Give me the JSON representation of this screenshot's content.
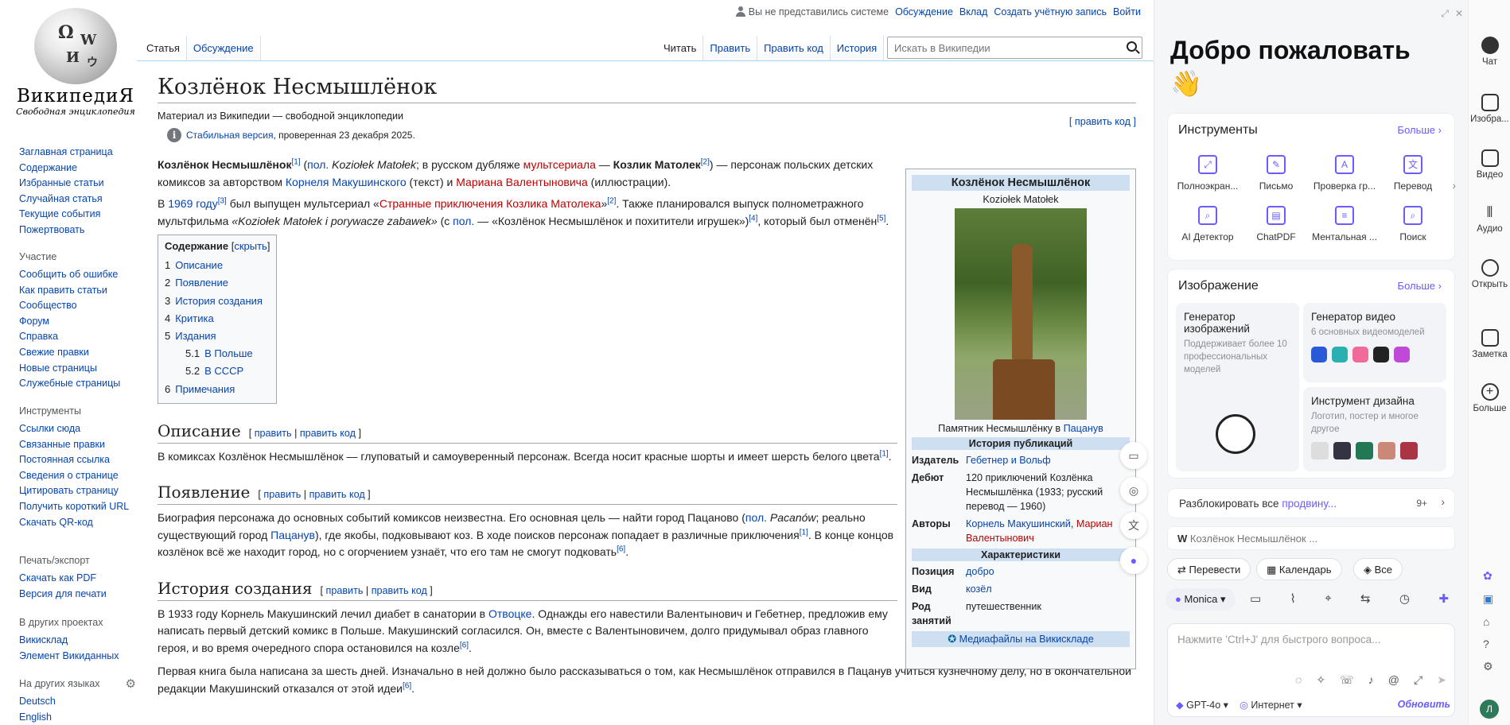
{
  "sidebar": {
    "wordmark": "ВикипедиЯ",
    "tagline": "Свободная энциклопедия",
    "nav": [
      "Заглавная страница",
      "Содержание",
      "Избранные статьи",
      "Случайная статья",
      "Текущие события",
      "Пожертвовать"
    ],
    "part_h": "Участие",
    "part": [
      "Сообщить об ошибке",
      "Как править статьи",
      "Сообщество",
      "Форум",
      "Справка",
      "Свежие правки",
      "Новые страницы",
      "Служебные страницы"
    ],
    "tools_h": "Инструменты",
    "tools": [
      "Ссылки сюда",
      "Связанные правки",
      "Постоянная ссылка",
      "Сведения о странице",
      "Цитировать страницу",
      "Получить короткий URL",
      "Скачать QR-код"
    ],
    "print_h": "Печать/экспорт",
    "print": [
      "Скачать как PDF",
      "Версия для печати"
    ],
    "proj_h": "В других проектах",
    "proj": [
      "Викисклад",
      "Элемент Викиданных"
    ],
    "lang_h": "На других языках",
    "langs": [
      "Deutsch",
      "English"
    ]
  },
  "topbar": {
    "notlogged": "Вы не представились системе",
    "talk": "Обсуждение",
    "contrib": "Вклад",
    "create": "Создать учётную запись",
    "login": "Войти"
  },
  "tabs": {
    "article": "Статья",
    "talk": "Обсуждение",
    "read": "Читать",
    "edit": "Править",
    "editsrc": "Править код",
    "history": "История"
  },
  "search": {
    "placeholder": "Искать в Википедии"
  },
  "article": {
    "title": "Козлёнок Несмышлёнок",
    "from": "Материал из Википедии — свободной энциклопедии",
    "editcode": "[ править код ]",
    "stable_link": "Стабильная версия",
    "stable_rest": ", проверенная 23 декабря 2025.",
    "p1": {
      "b1": "Козлёнок Несмышлёнок",
      "s1": "[1]",
      "t1": " (",
      "l1": "пол.",
      "t2": " ",
      "i1": "Koziołek Matołek",
      "t3": "; в русском дубляже ",
      "r1": "мультсериала",
      "t4": " — ",
      "b2": "Козлик Матолек",
      "s2": "[2]",
      "t5": ") — персонаж польских детских комиксов за авторством ",
      "l2": "Корнеля Макушинского",
      "t6": " (текст) и ",
      "r2": "Мариана Валентыновича",
      "t7": " (иллюстрации)."
    },
    "p2": {
      "t1": "В ",
      "l1": "1969 году",
      "s1": "[3]",
      "t2": " был выпущен мультсериал «",
      "r1": "Странные приключения Козлика Матолека",
      "t3": "»",
      "s2": "[2]",
      "t4": ". Также планировался выпуск полнометражного мультфильма ",
      "i1": "«Koziołek Matołek i porywacze zabawek»",
      "t5": " (с ",
      "l2": "пол.",
      "t6": " — «Козлёнок Несмышлёнок и похитители игрушек»)",
      "s3": "[4]",
      "t7": ", который был отменён",
      "s4": "[5]",
      "t8": "."
    },
    "toc": {
      "title": "Содержание",
      "hide": "скрыть",
      "items": [
        {
          "n": "1",
          "t": "Описание"
        },
        {
          "n": "2",
          "t": "Появление"
        },
        {
          "n": "3",
          "t": "История создания"
        },
        {
          "n": "4",
          "t": "Критика"
        },
        {
          "n": "5",
          "t": "Издания"
        },
        {
          "n": "5.1",
          "t": "В Польше"
        },
        {
          "n": "5.2",
          "t": "В СССР"
        },
        {
          "n": "6",
          "t": "Примечания"
        }
      ]
    },
    "edit": "править",
    "editsrc": "править код",
    "h_desc": "Описание",
    "p3": {
      "t1": "В комиксах Козлёнок Несмышлёнок — глуповатый и самоуверенный персонаж. Всегда носит красные шорты и имеет шерсть белого цвета",
      "s1": "[1]",
      "t2": "."
    },
    "h_app": "Появление",
    "p4": {
      "t1": "Биография персонажа до основных событий комиксов неизвестна. Его основная цель — найти город Пацаново (",
      "l1": "пол.",
      "t2": " ",
      "i1": "Pacanów",
      "t3": "; реально существующий город ",
      "l2": "Пацанув",
      "t4": "), где якобы, подковывают коз. В ходе поисков персонаж попадает в различные приключения",
      "s1": "[1]",
      "t5": ". В конце концов козлёнок всё же находит город, но с огорчением узнаёт, что его там не смогут подковать",
      "s2": "[6]",
      "t6": "."
    },
    "h_hist": "История создания",
    "p5": {
      "t1": "В 1933 году Корнель Макушинский лечил диабет в санатории в ",
      "l1": "Отвоцке",
      "t2": ". Однажды его навестили Валентынович и Гебетнер, предложив ему написать первый детский комикс в Польше. Макушинский согласился. Он, вместе с Валентыновичем, долго придумывал образ главного героя, и во время очередного спора остановился на козле",
      "s1": "[6]",
      "t3": "."
    },
    "p6": {
      "t1": "Первая книга была написана за шесть дней. Изначально в ней должно было рассказываться о том, как Несмышлёнок отправился в Пацанув учиться кузнечному делу, но в окончательной редакции Макушинский отказался от этой идеи",
      "s1": "[6]",
      "t2": "."
    }
  },
  "infobox": {
    "title": "Козлёнок Несмышлёнок",
    "subtitle": "Koziołek Matołek",
    "caption": "Памятник Несмышлёнку в ",
    "caption_link": "Пацанув",
    "sec1": "История публикаций",
    "publisher_k": "Издатель",
    "publisher_v": "Гебетнер и Вольф",
    "debut_k": "Дебют",
    "debut_v": "120 приключений Козлёнка Несмышлёнка (1933; русский перевод — 1960)",
    "authors_k": "Авторы",
    "author1": "Корнель Макушинский",
    "author2": "Мариан Валентынович",
    "sec2": "Характеристики",
    "pos_k": "Позиция",
    "pos_v": "добро",
    "kind_k": "Вид",
    "kind_v": "козёл",
    "occ_k": "Род занятий",
    "occ_v": "путешественник",
    "commons": "Медиафайлы на Викискладе"
  },
  "panel": {
    "welcome": "Добро пожаловать",
    "wave": "👋",
    "tools_t": "Инструменты",
    "more": "Больше",
    "tools": [
      "Полноэкран...",
      "Письмо",
      "Проверка гр...",
      "Перевод",
      "AI Детектор",
      "ChatPDF",
      "Ментальная ...",
      "Поиск"
    ],
    "image_t": "Изображение",
    "gen_img": "Генератор изображений",
    "gen_img_d": "Поддерживает более 10 профессиональных моделей",
    "gen_vid": "Генератор видео",
    "gen_vid_d": "6 основных видеомоделей",
    "design": "Инструмент дизайна",
    "design_d": "Логотип, постер и многое другое",
    "unlock": "Разблокировать все ",
    "unlock_p": "продвину...",
    "count": "9+",
    "page_chip": "Козлёнок Несмышлёнок ...",
    "chip1": "Перевести",
    "chip2": "Календарь",
    "chip3": "Все",
    "brand": "Monica",
    "input_ph": "Нажмите 'Ctrl+J' для быстрого вопроса...",
    "model": "GPT-4o",
    "web": "Интернет",
    "update": "Обновить"
  },
  "rail": [
    "Чат",
    "Изобра...",
    "Видео",
    "Аудио",
    "Открыть",
    "Заметка",
    "Больше"
  ],
  "colors": {
    "link": "#0645ad",
    "redlink": "#ba0000",
    "accent": "#6a5cff",
    "ibhead": "#cedff2"
  }
}
